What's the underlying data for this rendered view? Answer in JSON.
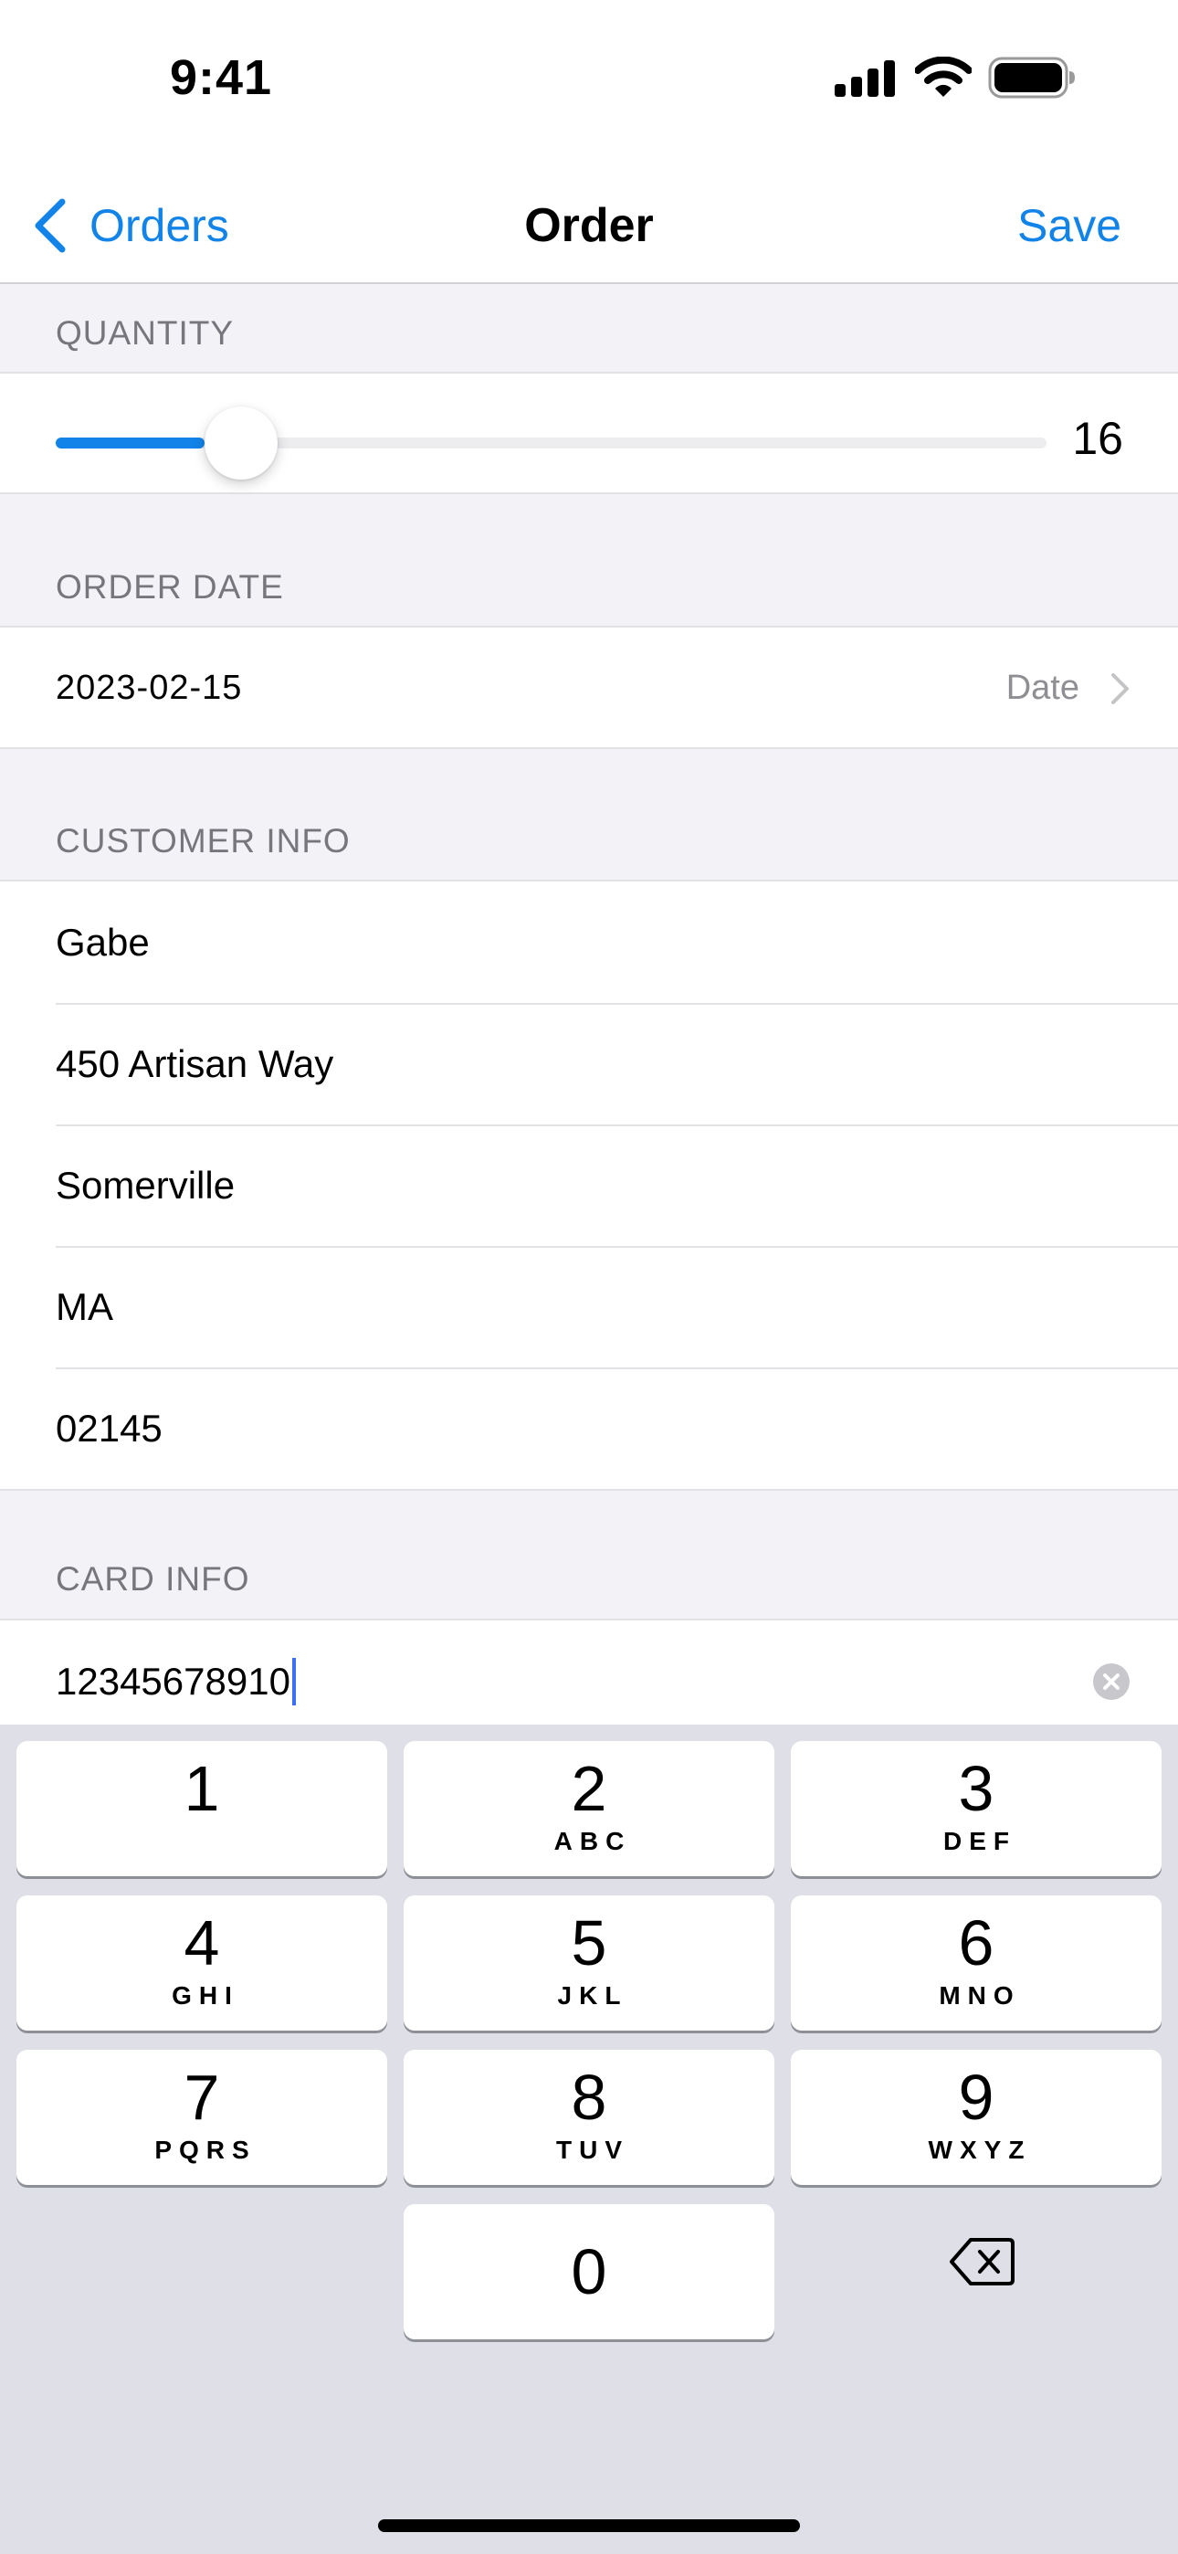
{
  "status_bar": {
    "time": "9:41"
  },
  "nav": {
    "back_label": "Orders",
    "title": "Order",
    "save_label": "Save"
  },
  "quantity": {
    "header": "QUANTITY",
    "value": "16",
    "fill_fraction": 0.15
  },
  "order_date": {
    "header": "ORDER DATE",
    "value": "2023-02-15",
    "picker_label": "Date"
  },
  "customer_info": {
    "header": "CUSTOMER INFO",
    "fields": [
      "Gabe",
      "450 Artisan Way",
      "Somerville",
      "MA",
      "02145"
    ]
  },
  "card_info": {
    "header": "CARD INFO",
    "value": "12345678910"
  },
  "keyboard": {
    "keys": [
      {
        "digit": "1",
        "letters": ""
      },
      {
        "digit": "2",
        "letters": "ABC"
      },
      {
        "digit": "3",
        "letters": "DEF"
      },
      {
        "digit": "4",
        "letters": "GHI"
      },
      {
        "digit": "5",
        "letters": "JKL"
      },
      {
        "digit": "6",
        "letters": "MNO"
      },
      {
        "digit": "7",
        "letters": "PQRS"
      },
      {
        "digit": "8",
        "letters": "TUV"
      },
      {
        "digit": "9",
        "letters": "WXYZ"
      },
      {
        "digit": "0",
        "letters": ""
      }
    ]
  },
  "colors": {
    "accent": "#1283e8",
    "caret": "#3d6ef6",
    "keyboard_bg": "#dfe0e7"
  }
}
